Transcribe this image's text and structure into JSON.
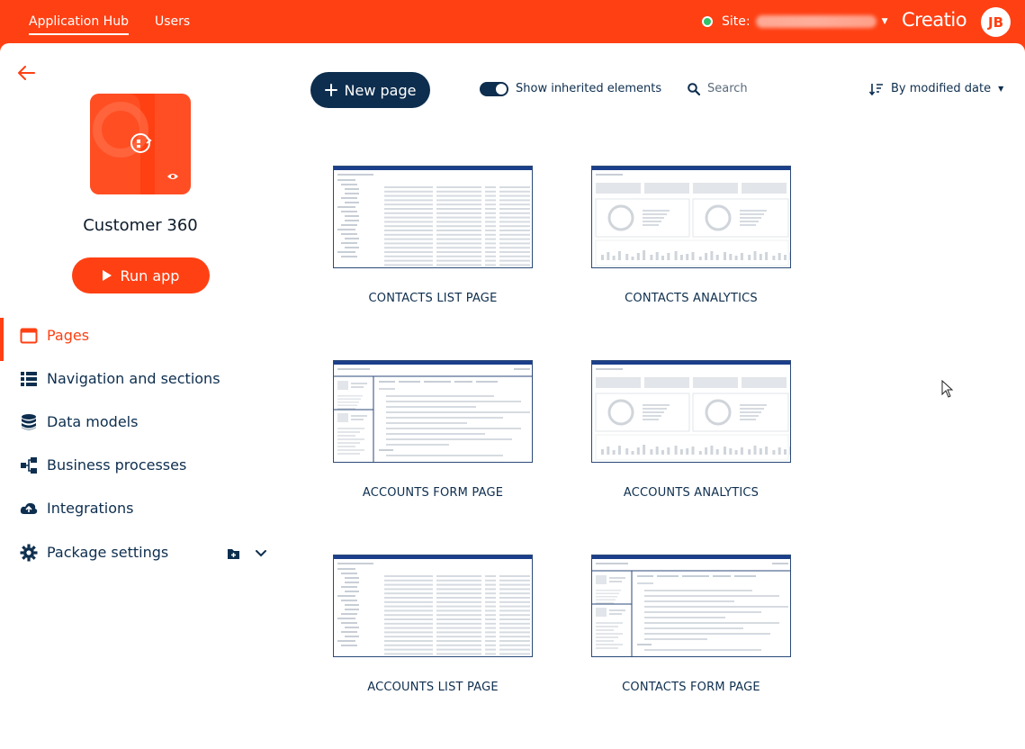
{
  "topbar": {
    "tabs": [
      {
        "label": "Application Hub"
      },
      {
        "label": "Users"
      }
    ],
    "site_label": "Site:",
    "logo": "Creatio",
    "avatar_initials": "JB",
    "colors": {
      "brand": "#ff4013",
      "status_online": "#2ec26b"
    }
  },
  "app": {
    "name": "Customer 360",
    "run_label": "Run app"
  },
  "nav": {
    "items": [
      {
        "label": "Pages",
        "icon": "browser-window-icon"
      },
      {
        "label": "Navigation and sections",
        "icon": "list-icon"
      },
      {
        "label": "Data models",
        "icon": "database-icon"
      },
      {
        "label": "Business processes",
        "icon": "process-icon"
      },
      {
        "label": "Integrations",
        "icon": "cloud-icon"
      },
      {
        "label": "Package settings",
        "icon": "gear-icon"
      }
    ]
  },
  "toolbar": {
    "new_page_label": "New page",
    "inherited_label": "Show inherited elements",
    "search_placeholder": "Search",
    "sort_label": "By modified date"
  },
  "pages": [
    {
      "label": "CONTACTS LIST PAGE",
      "kind": "list"
    },
    {
      "label": "CONTACTS ANALYTICS",
      "kind": "analytics"
    },
    {
      "label": "ACCOUNTS FORM PAGE",
      "kind": "form"
    },
    {
      "label": "ACCOUNTS ANALYTICS",
      "kind": "analytics"
    },
    {
      "label": "ACCOUNTS LIST PAGE",
      "kind": "list"
    },
    {
      "label": "CONTACTS FORM PAGE",
      "kind": "form"
    }
  ]
}
